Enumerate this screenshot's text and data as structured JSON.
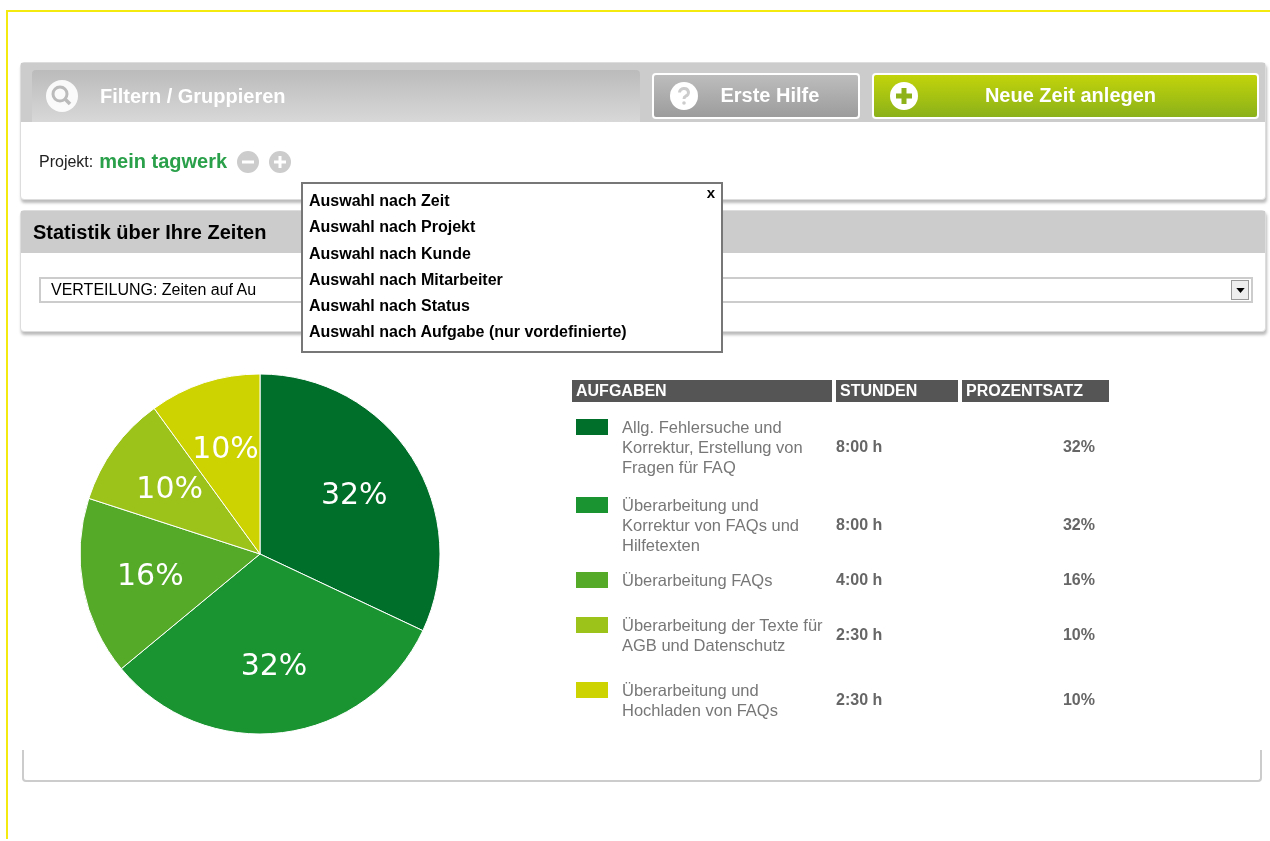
{
  "toolbar": {
    "filter_tab": "Filtern / Gruppieren",
    "help_button": "Erste Hilfe",
    "new_button": "Neue Zeit anlegen"
  },
  "filter": {
    "label": "Projekt:",
    "value": "mein tagwerk"
  },
  "popup": {
    "close": "x",
    "items": [
      "Auswahl nach Zeit",
      "Auswahl nach Projekt",
      "Auswahl nach Kunde",
      "Auswahl nach Mitarbeiter",
      "Auswahl nach Status",
      "Auswahl nach Aufgabe (nur vordefinierte)"
    ]
  },
  "stats": {
    "title": "Statistik über Ihre Zeiten",
    "select_value": "VERTEILUNG: Zeiten auf Au"
  },
  "chart_data": {
    "type": "pie",
    "values": [
      32,
      32,
      16,
      10,
      10
    ],
    "value_labels": [
      "32%",
      "32%",
      "16%",
      "10%",
      "10%"
    ]
  },
  "table": {
    "columns": [
      "AUFGABEN",
      "STUNDEN",
      "PROZENTSATZ"
    ],
    "rows": [
      {
        "color": "#006f29",
        "task": "Allg. Fehlersuche und Korrektur, Erstellung von Fragen für FAQ",
        "hours": "8:00 h",
        "percent": "32%"
      },
      {
        "color": "#199431",
        "task": "Überarbeitung und Korrektur von FAQs und Hilfetexten",
        "hours": "8:00 h",
        "percent": "32%"
      },
      {
        "color": "#55aa28",
        "task": "Überarbeitung FAQs",
        "hours": "4:00 h",
        "percent": "16%"
      },
      {
        "color": "#9bc31a",
        "task": "Überarbeitung der Texte für AGB und Datenschutz",
        "hours": "2:30 h",
        "percent": "10%"
      },
      {
        "color": "#ccd300",
        "task": "Überarbeitung und Hochladen von FAQs",
        "hours": "2:30 h",
        "percent": "10%"
      }
    ]
  }
}
